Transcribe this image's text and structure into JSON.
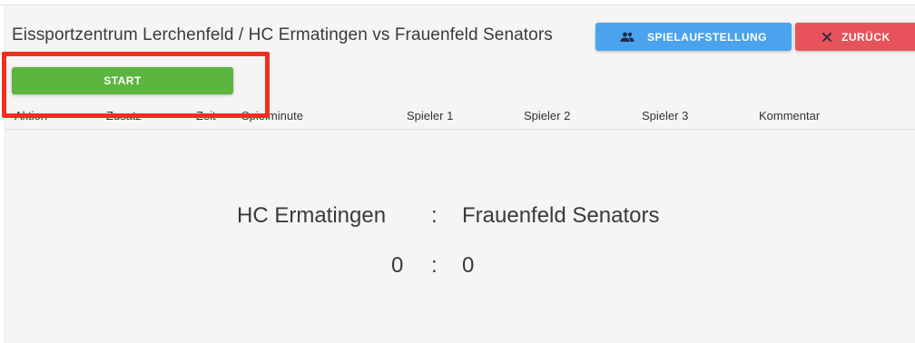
{
  "header": {
    "title": "Eissportzentrum Lerchenfeld / HC Ermatingen vs Frauenfeld Senators",
    "lineup_label": "SPIELAUFSTELLUNG",
    "lineup_icon": "people-icon",
    "back_label": "ZURÜCK",
    "back_icon": "close-icon"
  },
  "start_label": "START",
  "columns": [
    "Aktion",
    "Zusatz",
    "Zeit",
    "Spielminute",
    "Spieler 1",
    "Spieler 2",
    "Spieler 3",
    "Kommentar"
  ],
  "match": {
    "home_team": "HC Ermatingen",
    "separator": ":",
    "away_team": "Frauenfeld Senators",
    "home_score": "0",
    "score_separator": ":",
    "away_score": "0"
  },
  "colors": {
    "lineup_button": "#4aa3ec",
    "back_button": "#e8525a",
    "start_button": "#5cb53f",
    "highlight": "#f0301f"
  }
}
